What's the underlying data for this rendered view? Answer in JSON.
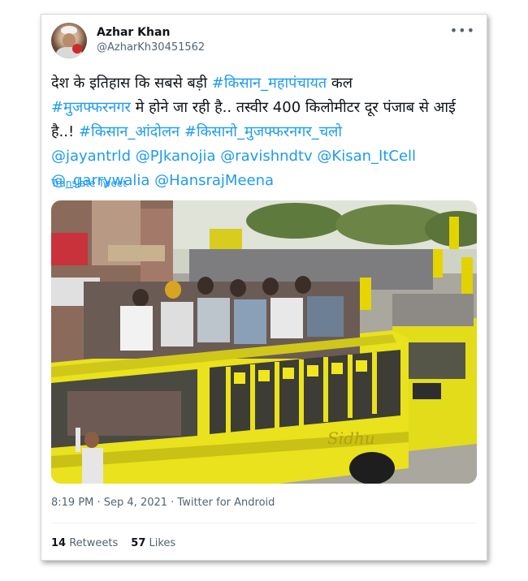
{
  "author": {
    "name": "Azhar Khan",
    "handle": "@AzharKh30451562"
  },
  "menu_icon": "more-dots-icon",
  "tweet": {
    "text_1": "देश के इतिहास कि सबसे बड़ी ",
    "hashtag_1": "#किसान_महापंचायत",
    "text_2": " कल ",
    "hashtag_2": "#मुजफ्फरनगर",
    "text_3": " मे होने जा रही है.. तस्वीर 400 किलोमीटर दूर पंजाब से आई है..! ",
    "hashtag_3": "#किसान_आंदोलन",
    "text_4": " ",
    "hashtag_4": "#किसानो_मुजफ्फरनगर_चलो",
    "mention_1": "@jayantrld",
    "mention_2": "@PJkanojia",
    "mention_3": "@ravishndtv",
    "mention_4": "@Kisan_ItCell",
    "mention_5": "@_garrywalia",
    "mention_6": "@HansrajMeena"
  },
  "translate_label": "Translate Tweet",
  "photo": {
    "bus_text": "Sidhu"
  },
  "meta": "8:19 PM · Sep 4, 2021 · Twitter for Android",
  "stats": {
    "retweets_count": "14",
    "retweets_label": "Retweets",
    "likes_count": "57",
    "likes_label": "Likes"
  },
  "colors": {
    "link": "#1d9bf0",
    "text": "#0f1419",
    "muted": "#536471",
    "bus_yellow": "#e9e21c"
  }
}
